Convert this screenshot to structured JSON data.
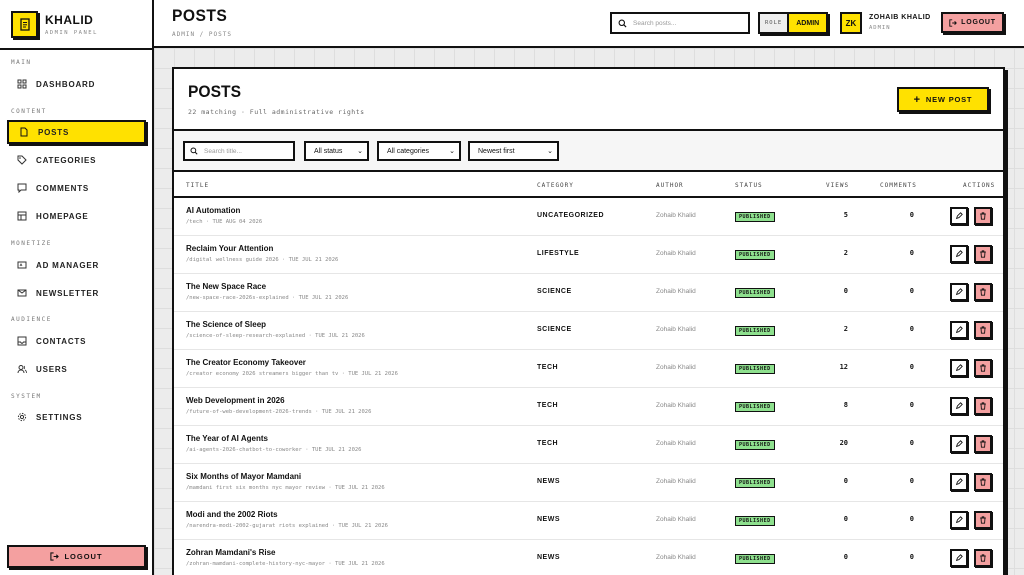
{
  "brand": {
    "name": "KHALID",
    "subtitle": "ADMIN PANEL"
  },
  "sidebar": {
    "sections": [
      "MAIN",
      "CONTENT",
      "MONETIZE",
      "AUDIENCE",
      "SYSTEM"
    ],
    "items": [
      {
        "label": "DASHBOARD",
        "icon": "grid-icon"
      },
      {
        "label": "POSTS",
        "icon": "document-icon",
        "active": true
      },
      {
        "label": "CATEGORIES",
        "icon": "tag-icon"
      },
      {
        "label": "COMMENTS",
        "icon": "comment-icon"
      },
      {
        "label": "HOMEPAGE",
        "icon": "layout-icon"
      },
      {
        "label": "AD MANAGER",
        "icon": "ad-icon"
      },
      {
        "label": "NEWSLETTER",
        "icon": "mail-icon"
      },
      {
        "label": "CONTACTS",
        "icon": "inbox-icon"
      },
      {
        "label": "USERS",
        "icon": "users-icon"
      },
      {
        "label": "SETTINGS",
        "icon": "gear-icon"
      }
    ],
    "logout": "LOGOUT"
  },
  "header": {
    "title": "POSTS",
    "breadcrumb": "ADMIN / POSTS",
    "search_placeholder": "Search posts...",
    "role_label": "ROLE",
    "role_value": "ADMIN",
    "avatar": "ZK",
    "user_name": "ZOHAIB KHALID",
    "user_role": "ADMIN",
    "logout": "LOGOUT"
  },
  "card": {
    "title": "POSTS",
    "subtitle": "22 matching · Full administrative rights",
    "new_button": "NEW POST"
  },
  "filters": {
    "search_placeholder": "Search title...",
    "status": "All status",
    "category": "All categories",
    "sort": "Newest first"
  },
  "columns": [
    "TITLE",
    "CATEGORY",
    "AUTHOR",
    "STATUS",
    "VIEWS",
    "COMMENTS",
    "ACTIONS"
  ],
  "rows": [
    {
      "title": "AI Automation",
      "slug": "/tech · TUE AUG 04 2026",
      "category": "UNCATEGORIZED",
      "author": "Zohaib Khalid",
      "status": "PUBLISHED",
      "views": "5",
      "comments": "0"
    },
    {
      "title": "Reclaim Your Attention",
      "slug": "/digital wellness guide 2026 · TUE JUL 21 2026",
      "category": "LIFESTYLE",
      "author": "Zohaib Khalid",
      "status": "PUBLISHED",
      "views": "2",
      "comments": "0"
    },
    {
      "title": "The New Space Race",
      "slug": "/new-space-race-2026s-explained · TUE JUL 21 2026",
      "category": "SCIENCE",
      "author": "Zohaib Khalid",
      "status": "PUBLISHED",
      "views": "0",
      "comments": "0"
    },
    {
      "title": "The Science of Sleep",
      "slug": "/science-of-sleep-research-explained · TUE JUL 21 2026",
      "category": "SCIENCE",
      "author": "Zohaib Khalid",
      "status": "PUBLISHED",
      "views": "2",
      "comments": "0"
    },
    {
      "title": "The Creator Economy Takeover",
      "slug": "/creator economy 2026 streamers bigger than tv · TUE JUL 21 2026",
      "category": "TECH",
      "author": "Zohaib Khalid",
      "status": "PUBLISHED",
      "views": "12",
      "comments": "0"
    },
    {
      "title": "Web Development in 2026",
      "slug": "/future-of-web-development-2026-trends · TUE JUL 21 2026",
      "category": "TECH",
      "author": "Zohaib Khalid",
      "status": "PUBLISHED",
      "views": "8",
      "comments": "0"
    },
    {
      "title": "The Year of AI Agents",
      "slug": "/ai-agents-2026-chatbot-to-coworker · TUE JUL 21 2026",
      "category": "TECH",
      "author": "Zohaib Khalid",
      "status": "PUBLISHED",
      "views": "20",
      "comments": "0"
    },
    {
      "title": "Six Months of Mayor Mamdani",
      "slug": "/mamdani first six months nyc mayor review · TUE JUL 21 2026",
      "category": "NEWS",
      "author": "Zohaib Khalid",
      "status": "PUBLISHED",
      "views": "0",
      "comments": "0"
    },
    {
      "title": "Modi and the 2002 Riots",
      "slug": "/narendra-modi-2002-gujarat riots explained · TUE JUL 21 2026",
      "category": "NEWS",
      "author": "Zohaib Khalid",
      "status": "PUBLISHED",
      "views": "0",
      "comments": "0"
    },
    {
      "title": "Zohran Mamdani's Rise",
      "slug": "/zohran-mamdani-complete-history-nyc-mayor · TUE JUL 21 2026",
      "category": "NEWS",
      "author": "Zohaib Khalid",
      "status": "PUBLISHED",
      "views": "0",
      "comments": "0"
    }
  ],
  "colors": {
    "accent": "#ffe100",
    "danger": "#f4a0a0",
    "published": "#8ee08e",
    "border": "#111111"
  }
}
